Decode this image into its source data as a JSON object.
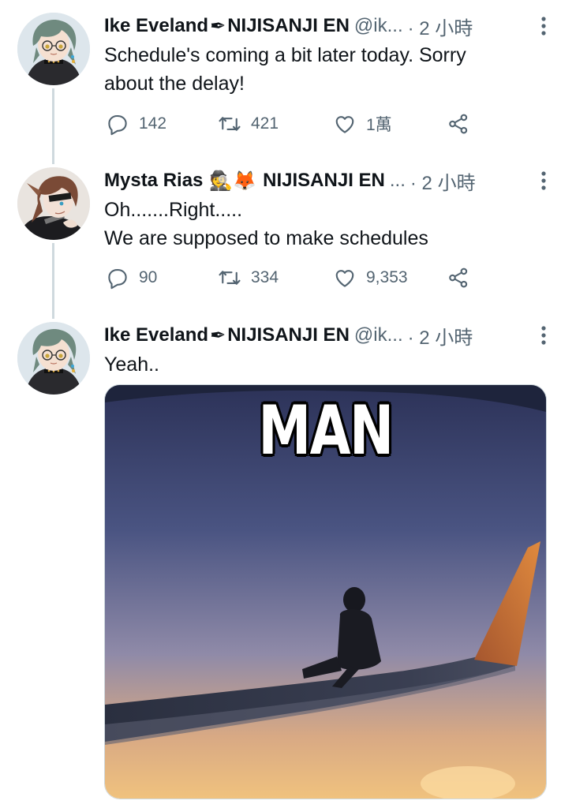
{
  "tweets": [
    {
      "name": "Ike Eveland",
      "name_emoji": "✒",
      "affiliation": "NIJISANJI EN",
      "handle": "@ik...",
      "time": "· 2 小時",
      "text_lines": [
        "Schedule's coming a bit later today. Sorry",
        "about the delay!"
      ],
      "replies": "142",
      "retweets": "421",
      "likes": "1萬"
    },
    {
      "name": "Mysta Rias",
      "name_emoji": "🕵🦊",
      "affiliation": "NIJISANJI EN",
      "handle": "...",
      "time": "· 2 小時",
      "text_lines": [
        "Oh.......Right.....",
        "We are supposed to make schedules"
      ],
      "replies": "90",
      "retweets": "334",
      "likes": "9,353"
    },
    {
      "name": "Ike Eveland",
      "name_emoji": "✒",
      "affiliation": "NIJISANJI EN",
      "handle": "@ik...",
      "time": "· 2 小時",
      "text_lines": [
        "Yeah.."
      ],
      "media_caption": "MAN"
    }
  ],
  "icons": {
    "reply": "reply-icon",
    "retweet": "retweet-icon",
    "like": "heart-icon",
    "share": "share-icon",
    "more": "more-vertical-icon"
  },
  "colors": {
    "text": "#0f1419",
    "secondary": "#536471",
    "thread_line": "#cfd9de"
  }
}
